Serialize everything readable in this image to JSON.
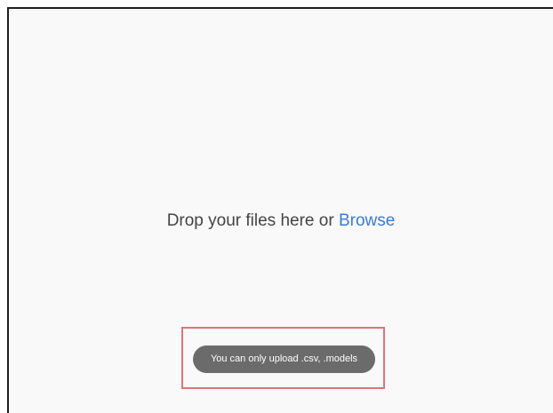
{
  "dropzone": {
    "prompt_text": "Drop your files here or",
    "browse_label": "Browse"
  },
  "toast": {
    "message": "You can only upload .csv, .models"
  },
  "colors": {
    "link": "#3a7bd5",
    "toast_background": "#6b6b6b",
    "highlight_border": "#e0737a",
    "dropzone_background": "#f9f9f9"
  }
}
